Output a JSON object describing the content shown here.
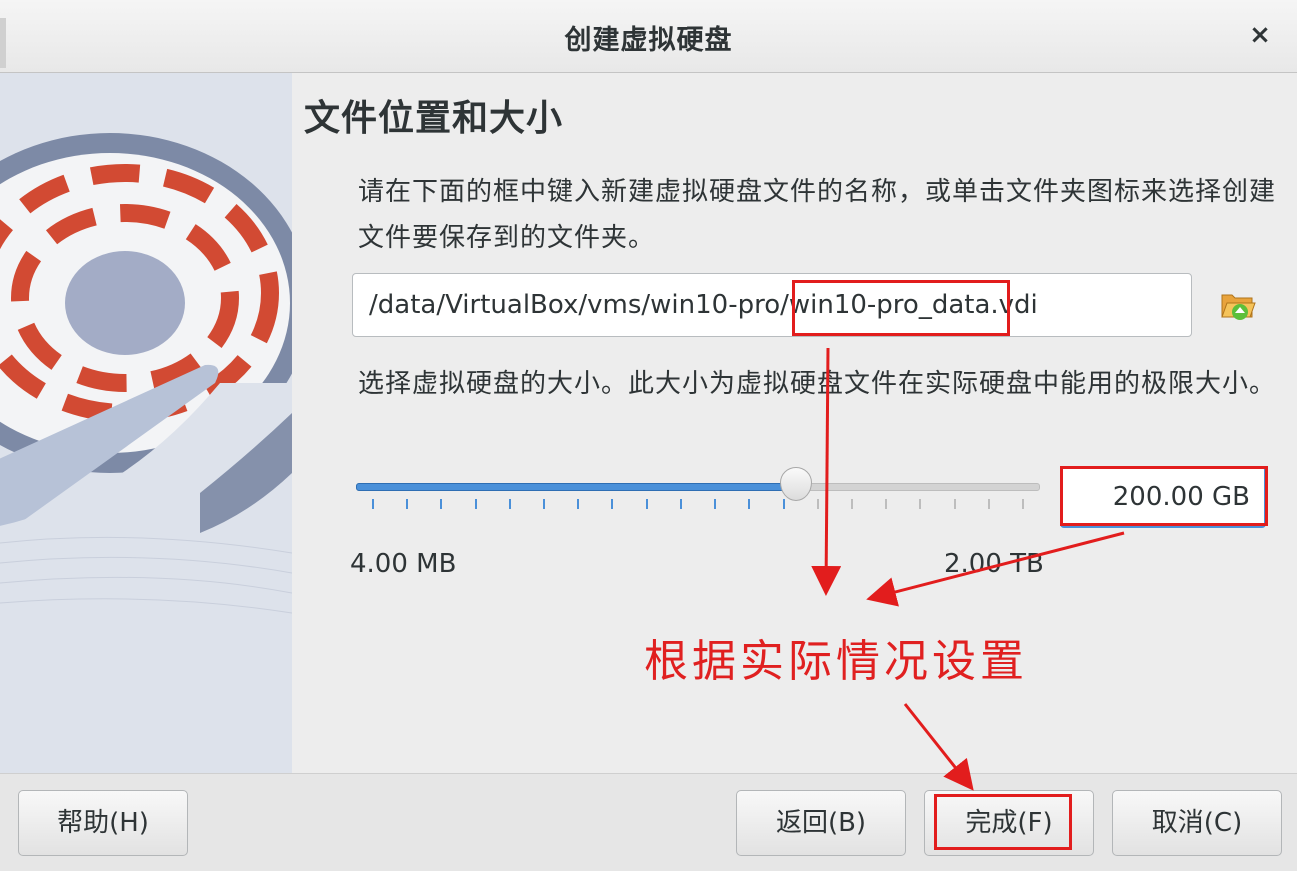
{
  "window": {
    "title": "创建虚拟硬盘",
    "close_label": "×"
  },
  "page": {
    "heading": "文件位置和大小",
    "location_description": "请在下面的框中键入新建虚拟硬盘文件的名称，或单击文件夹图标来选择创建文件要保存到的文件夹。",
    "file_path_prefix": "/data/VirtualBox/vms/win10-pro/",
    "file_name": "win10-pro_data",
    "file_extension": ".vdi",
    "size_description": "选择虚拟硬盘的大小。此大小为虚拟硬盘文件在实际硬盘中能用的极限大小。",
    "size_value": "200.00 GB",
    "size_min_label": "4.00 MB",
    "size_max_label": "2.00 TB",
    "slider_fraction": 0.645
  },
  "annotation": {
    "text": "根据实际情况设置",
    "color": "#e02020"
  },
  "buttons": {
    "help": "帮助(H)",
    "back": "返回(B)",
    "finish": "完成(F)",
    "cancel": "取消(C)"
  },
  "icons": {
    "folder": "folder-open-icon",
    "close": "close-icon",
    "side_art": "hard-disk-illustration"
  },
  "colors": {
    "accent": "#4a90d9",
    "annotation_red": "#e21d1d"
  }
}
